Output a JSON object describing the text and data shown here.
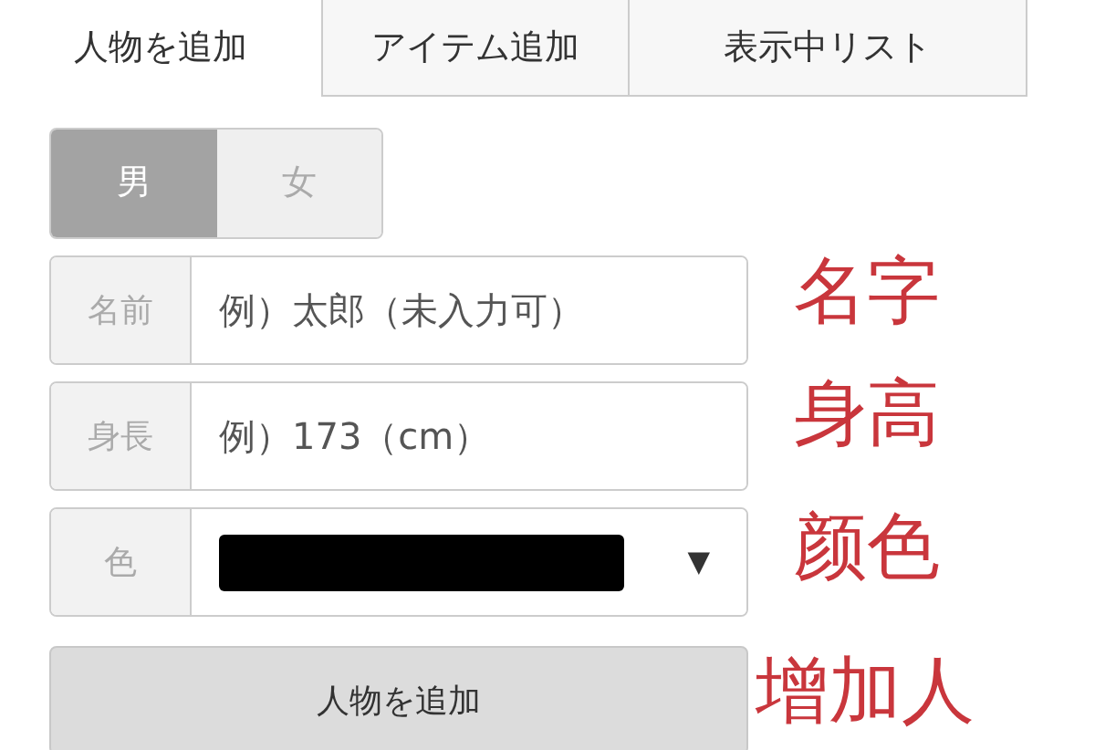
{
  "tabs": [
    {
      "label": "人物を追加",
      "selected": true
    },
    {
      "label": "アイテム追加",
      "selected": false
    },
    {
      "label": "表示中リスト",
      "selected": false
    }
  ],
  "gender": [
    {
      "label": "男",
      "selected": true
    },
    {
      "label": "女",
      "selected": false
    }
  ],
  "fields": [
    {
      "kind": "text",
      "label": "名前",
      "placeholder": "例）太郎（未入力可）"
    },
    {
      "kind": "text",
      "label": "身長",
      "placeholder": "例）173（cm）"
    },
    {
      "kind": "color",
      "label": "色",
      "color": "#000000",
      "caret": "▼"
    }
  ],
  "submit_button": "人物を追加",
  "annotations": [
    "名字",
    "身高",
    "颜色",
    "增加人"
  ]
}
